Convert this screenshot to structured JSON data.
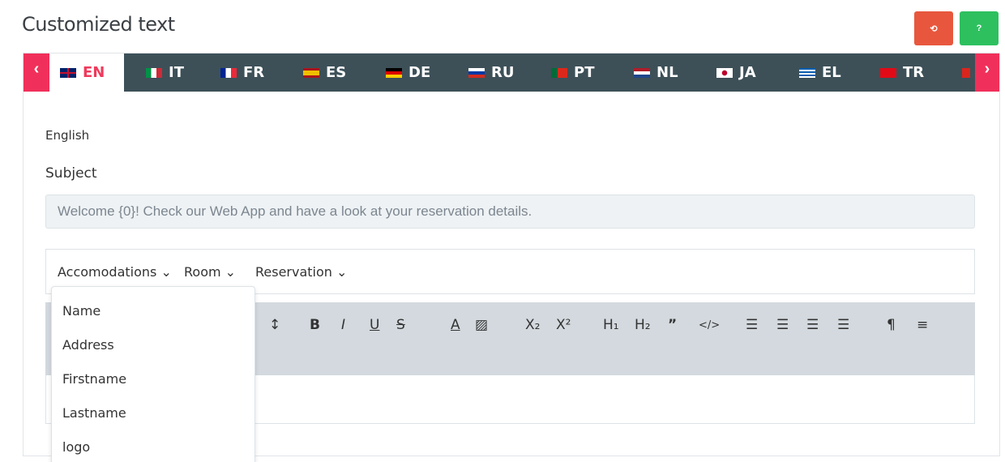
{
  "page": {
    "title": "Customized text"
  },
  "header_buttons": {
    "reset_icon": "reset-icon",
    "help_label": "?"
  },
  "tabs": [
    {
      "code": "EN",
      "flag_colors": [
        "#c8102e",
        "#012169",
        "#ffffff"
      ]
    },
    {
      "code": "IT",
      "flag_colors": [
        "#009246",
        "#ffffff",
        "#ce2b37"
      ]
    },
    {
      "code": "FR",
      "flag_colors": [
        "#002395",
        "#ffffff",
        "#ed2939"
      ]
    },
    {
      "code": "ES",
      "flag_colors": [
        "#aa151b",
        "#f1bf00",
        "#aa151b"
      ]
    },
    {
      "code": "DE",
      "flag_colors": [
        "#000000",
        "#dd0000",
        "#ffce00"
      ]
    },
    {
      "code": "RU",
      "flag_colors": [
        "#ffffff",
        "#0039a6",
        "#d52b1e"
      ]
    },
    {
      "code": "PT",
      "flag_colors": [
        "#046a38",
        "#da291c",
        "#da291c"
      ]
    },
    {
      "code": "NL",
      "flag_colors": [
        "#ae1c28",
        "#ffffff",
        "#21468b"
      ]
    },
    {
      "code": "JA",
      "flag_colors": [
        "#ffffff",
        "#bc002d",
        "#ffffff"
      ]
    },
    {
      "code": "EL",
      "flag_colors": [
        "#0d5eaf",
        "#ffffff",
        "#0d5eaf"
      ]
    },
    {
      "code": "TR",
      "flag_colors": [
        "#e30a17",
        "#ffffff",
        "#e30a17"
      ]
    }
  ],
  "content": {
    "language": "English",
    "subject_label": "Subject",
    "subject_value": "Welcome {0}! Check our Web App and have a look at your reservation details."
  },
  "placeholders": {
    "menus": [
      "Accomodations",
      "Room",
      "Reservation"
    ],
    "open_menu_items": [
      "Name",
      "Address",
      "Firstname",
      "Lastname",
      "logo"
    ]
  },
  "toolbar": {
    "tools": [
      "↕",
      "B",
      "I",
      "U",
      "S",
      "A",
      "▨",
      "X₂",
      "X²",
      "H₁",
      "H₂",
      "”",
      "</>",
      "☰",
      "☰",
      "☰",
      "☰",
      "¶",
      "≡"
    ]
  },
  "colors": {
    "accent": "#ef3b5c",
    "tabbar": "#3d5058",
    "reset": "#e8573d",
    "help": "#2ec05f"
  }
}
